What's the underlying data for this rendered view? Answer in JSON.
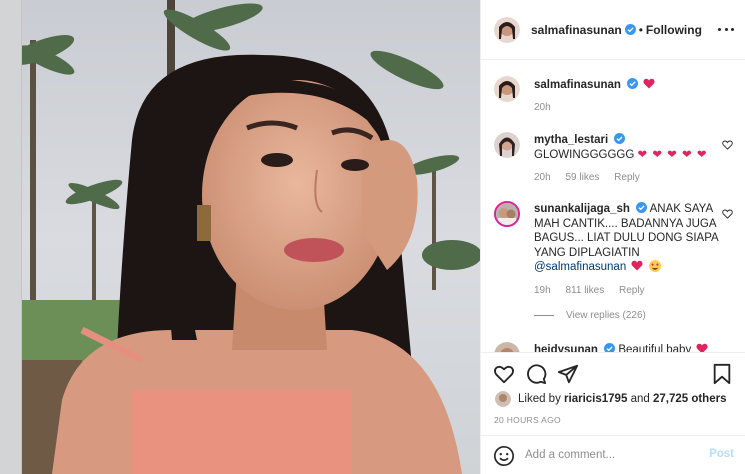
{
  "post": {
    "author": "salmafinasunan",
    "follow_status": "Following",
    "dot": "•",
    "caption_author": "salmafinasunan",
    "caption_time": "20h",
    "likes_prefix": "Liked by",
    "liked_by_user": "riaricis1795",
    "likes_and": "and",
    "likes_count": "27,725 others",
    "timestamp": "20 HOURS AGO"
  },
  "comments": [
    {
      "user": "mytha_lestari",
      "text": "GLOWINGGGGGG",
      "hearts": "❤ ❤ ❤ ❤ ❤",
      "time": "20h",
      "likes": "59 likes",
      "reply": "Reply"
    },
    {
      "user": "sunankalijaga_sh",
      "text": "ANAK SAYA MAH CANTIK.... BADANNYA JUGA BAGUS... LIAT DULU DONG SIAPA YANG DIPLAGIATIN",
      "mention": "@salmafinasunan",
      "time": "19h",
      "likes": "811 likes",
      "reply": "Reply",
      "view_replies": "View replies (226)"
    },
    {
      "user": "heidysunan",
      "text": "Beautiful baby"
    }
  ],
  "add_comment": {
    "placeholder": "Add a comment...",
    "post_label": "Post"
  },
  "colors": {
    "verified": "#3897f0",
    "heart_red": "#ed4956",
    "post_disabled": "#b2dffc",
    "secondary_text": "#8e8e8e"
  },
  "icons": [
    "verified-badge-icon",
    "more-options-icon",
    "heart-icon",
    "comment-icon",
    "share-icon",
    "bookmark-icon",
    "emoji-icon"
  ]
}
